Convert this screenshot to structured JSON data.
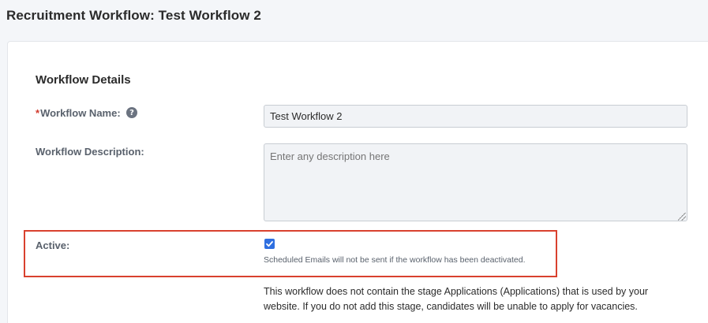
{
  "page": {
    "title": "Recruitment Workflow: Test Workflow 2"
  },
  "section": {
    "title": "Workflow Details"
  },
  "fields": {
    "name": {
      "required_marker": "*",
      "label": "Workflow Name:",
      "help_icon": "question-circle-icon",
      "value": "Test Workflow 2"
    },
    "description": {
      "label": "Workflow Description:",
      "placeholder": "Enter any description here",
      "value": ""
    },
    "active": {
      "label": "Active:",
      "checked": true,
      "hint": "Scheduled Emails will not be sent if the workflow has been deactivated."
    }
  },
  "notice": "This workflow does not contain the stage Applications (Applications) that is used by your website. If you do not add this stage, candidates will be unable to apply for vacancies.",
  "colors": {
    "required": "#d13a2d",
    "highlight": "#d9412e",
    "checkbox": "#2f6fe0"
  }
}
